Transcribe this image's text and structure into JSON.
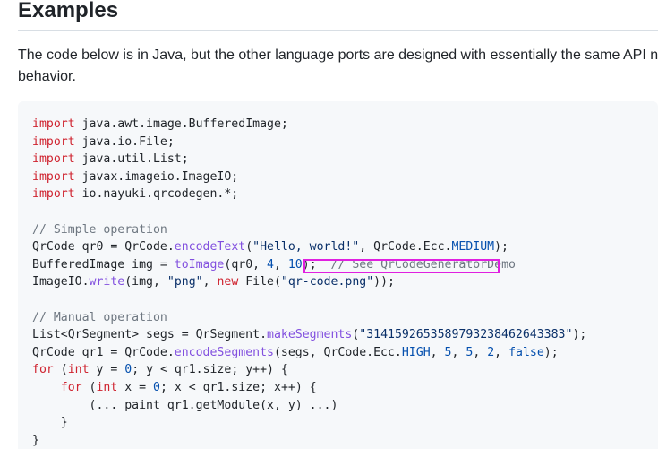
{
  "section": {
    "heading": "Examples",
    "paragraph": "The code below is in Java, but the other language ports are designed with essentially the same API na behavior."
  },
  "code_lines": [
    [
      [
        "kw",
        "import"
      ],
      [
        "p",
        " java.awt.image.BufferedImage;"
      ]
    ],
    [
      [
        "kw",
        "import"
      ],
      [
        "p",
        " java.io.File;"
      ]
    ],
    [
      [
        "kw",
        "import"
      ],
      [
        "p",
        " java.util.List;"
      ]
    ],
    [
      [
        "kw",
        "import"
      ],
      [
        "p",
        " javax.imageio.ImageIO;"
      ]
    ],
    [
      [
        "kw",
        "import"
      ],
      [
        "p",
        " io.nayuki.qrcodegen.*;"
      ]
    ],
    [],
    [
      [
        "cmt",
        "// Simple operation"
      ]
    ],
    [
      [
        "p",
        "QrCode qr0 = QrCode."
      ],
      [
        "fn",
        "encodeText"
      ],
      [
        "p",
        "("
      ],
      [
        "str",
        "\"Hello, world!\""
      ],
      [
        "p",
        ", QrCode.Ecc."
      ],
      [
        "const",
        "MEDIUM"
      ],
      [
        "p",
        ");"
      ]
    ],
    [
      [
        "p",
        "BufferedImage img = "
      ],
      [
        "fn",
        "toImage"
      ],
      [
        "p",
        "(qr0, "
      ],
      [
        "const",
        "4"
      ],
      [
        "p",
        ", "
      ],
      [
        "const",
        "10"
      ],
      [
        "p",
        ");  "
      ],
      [
        "cmt",
        "// See QrCodeGeneratorDemo"
      ]
    ],
    [
      [
        "p",
        "ImageIO."
      ],
      [
        "fn",
        "write"
      ],
      [
        "p",
        "(img, "
      ],
      [
        "str",
        "\"png\""
      ],
      [
        "p",
        ", "
      ],
      [
        "kw",
        "new"
      ],
      [
        "p",
        " File("
      ],
      [
        "str",
        "\"qr-code.png\""
      ],
      [
        "p",
        "));"
      ]
    ],
    [],
    [
      [
        "cmt",
        "// Manual operation"
      ]
    ],
    [
      [
        "p",
        "List<QrSegment> segs = QrSegment."
      ],
      [
        "fn",
        "makeSegments"
      ],
      [
        "p",
        "("
      ],
      [
        "str",
        "\"3141592653589793238462643383\""
      ],
      [
        "p",
        ");"
      ]
    ],
    [
      [
        "p",
        "QrCode qr1 = QrCode."
      ],
      [
        "fn",
        "encodeSegments"
      ],
      [
        "p",
        "(segs, QrCode.Ecc."
      ],
      [
        "const",
        "HIGH"
      ],
      [
        "p",
        ", "
      ],
      [
        "const",
        "5"
      ],
      [
        "p",
        ", "
      ],
      [
        "const",
        "5"
      ],
      [
        "p",
        ", "
      ],
      [
        "const",
        "2"
      ],
      [
        "p",
        ", "
      ],
      [
        "const",
        "false"
      ],
      [
        "p",
        ");"
      ]
    ],
    [
      [
        "kw",
        "for"
      ],
      [
        "p",
        " ("
      ],
      [
        "kw",
        "int"
      ],
      [
        "p",
        " y = "
      ],
      [
        "const",
        "0"
      ],
      [
        "p",
        "; y < qr1.size; y++) {"
      ]
    ],
    [
      [
        "p",
        "    "
      ],
      [
        "kw",
        "for"
      ],
      [
        "p",
        " ("
      ],
      [
        "kw",
        "int"
      ],
      [
        "p",
        " x = "
      ],
      [
        "const",
        "0"
      ],
      [
        "p",
        "; x < qr1.size; x++) {"
      ]
    ],
    [
      [
        "p",
        "        (... paint qr1.getModule(x, y) ...)"
      ]
    ],
    [
      [
        "p",
        "    }"
      ]
    ],
    [
      [
        "p",
        "}"
      ]
    ]
  ]
}
